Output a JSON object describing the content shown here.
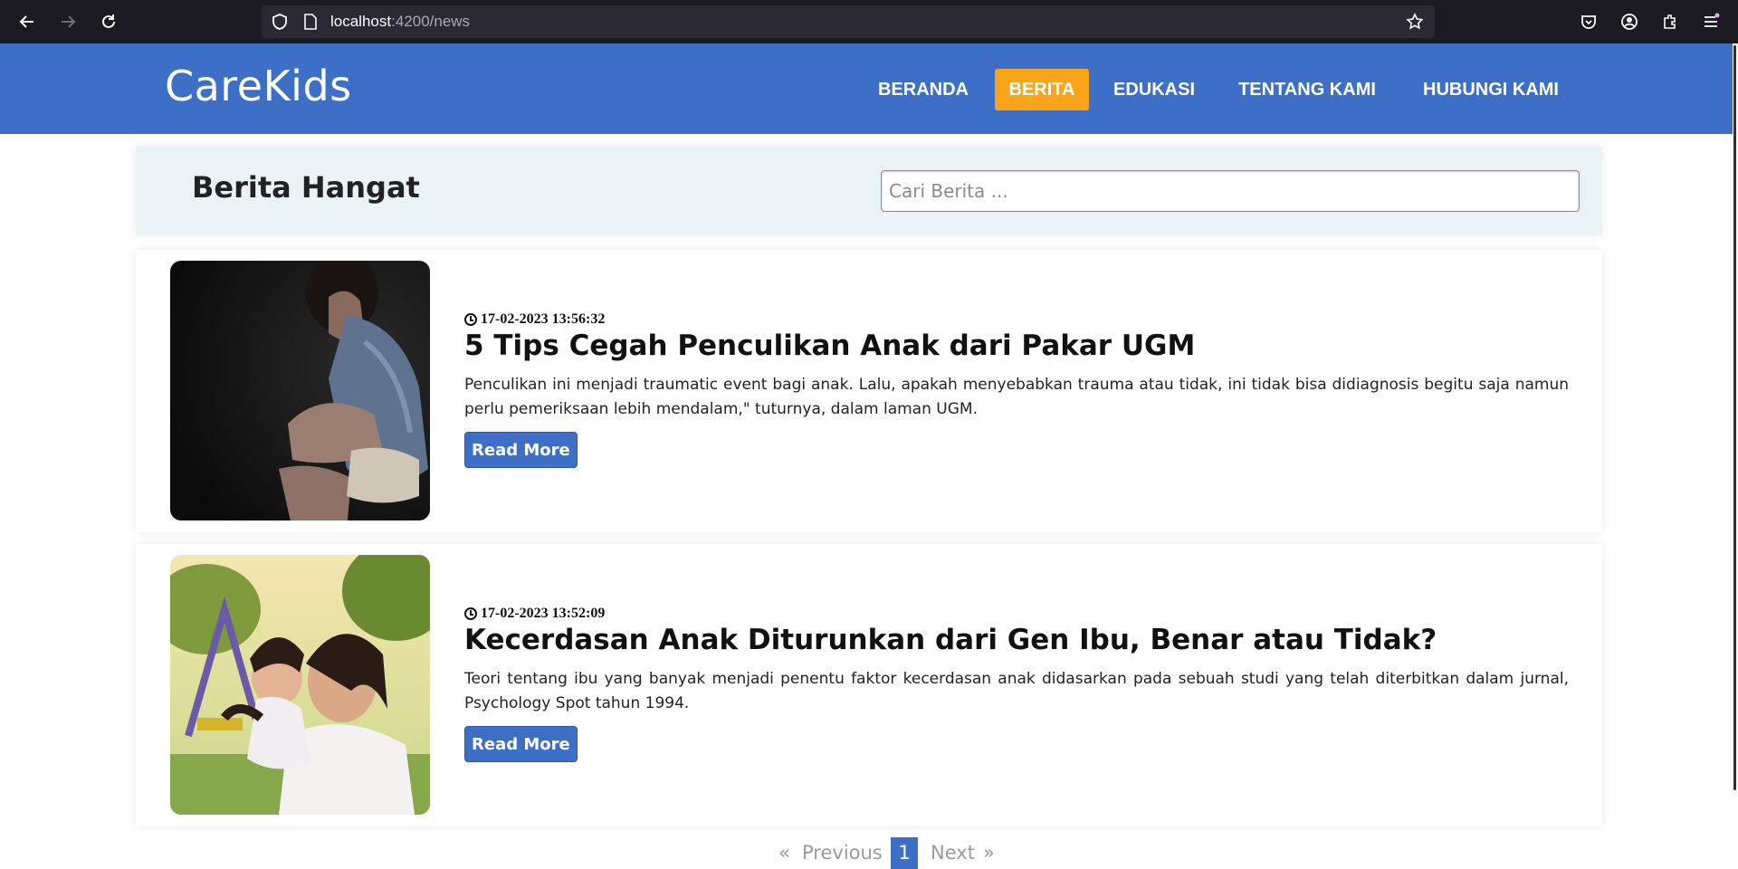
{
  "browser": {
    "url_host": "localhost",
    "url_path": ":4200/news"
  },
  "header": {
    "brand": "CareKids",
    "menu": [
      {
        "label": "BERANDA",
        "active": false
      },
      {
        "label": "BERITA",
        "active": true
      },
      {
        "label": "EDUKASI",
        "active": false
      },
      {
        "label": "TENTANG KAMI",
        "active": false
      },
      {
        "label": "HUBUNGI KAMI",
        "active": false
      }
    ]
  },
  "title_bar": {
    "title": "Berita Hangat",
    "search_placeholder": "Cari Berita ..."
  },
  "articles": [
    {
      "date": "17-02-2023 13:56:32",
      "title": "5 Tips Cegah Penculikan Anak dari Pakar UGM",
      "excerpt": "Penculikan ini menjadi traumatic event bagi anak. Lalu, apakah menyebabkan trauma atau tidak, ini tidak bisa didiagnosis begitu saja namun perlu pemeriksaan lebih mendalam,\" tuturnya, dalam laman UGM.",
      "button": "Read More"
    },
    {
      "date": "17-02-2023 13:52:09",
      "title": "Kecerdasan Anak Diturunkan dari Gen Ibu, Benar atau Tidak?",
      "excerpt": "Teori tentang ibu yang banyak menjadi penentu faktor kecerdasan anak didasarkan pada sebuah studi yang telah diterbitkan dalam jurnal, Psychology Spot tahun 1994.",
      "button": "Read More"
    }
  ],
  "pagination": {
    "prev_arrow": "«",
    "previous": "Previous",
    "current": "1",
    "next": "Next",
    "next_arrow": "»"
  }
}
